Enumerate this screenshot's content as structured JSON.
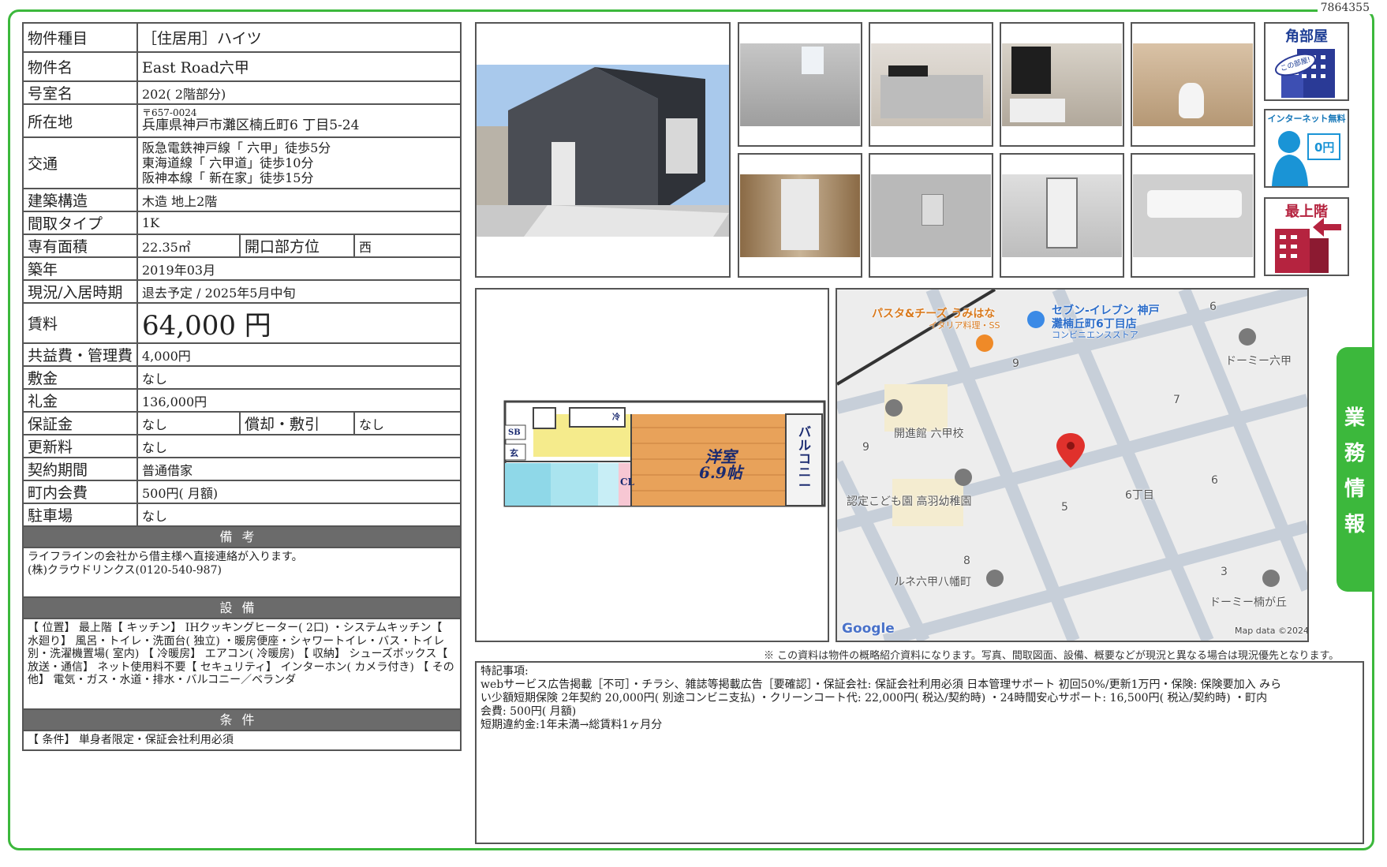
{
  "doc_id": "7864355",
  "property": {
    "type_label": "物件種目",
    "type": "［住居用］ハイツ",
    "name_label": "物件名",
    "name": "East Road六甲",
    "room_label": "号室名",
    "room": "202( 2階部分)",
    "location_label": "所在地",
    "postal": "〒657-0024",
    "address": "兵庫県神戸市灘区楠丘町6 丁目5-24",
    "traffic_label": "交通",
    "traffic": [
      "阪急電鉄神戸線「 六甲」徒歩5分",
      "東海道線「 六甲道」徒歩10分",
      "阪神本線「 新在家」徒歩15分"
    ],
    "structure_label": "建築構造",
    "structure": "木造 地上2階",
    "layout_label": "間取タイプ",
    "layout": "1K",
    "area_label": "専有面積",
    "area": "22.35㎡",
    "direction_label": "開口部方位",
    "direction": "西",
    "built_label": "築年",
    "built": "2019年03月",
    "status_label": "現況/入居時期",
    "status": "退去予定 / 2025年5月中旬",
    "rent_label": "賃料",
    "rent": "64,000 円",
    "fee_label": "共益費・管理費",
    "fee": "4,000円",
    "deposit_label": "敷金",
    "deposit": "なし",
    "key_money_label": "礼金",
    "key_money": "136,000円",
    "guarantee_label": "保証金",
    "guarantee": "なし",
    "amortization_label": "償却・敷引",
    "amortization": "なし",
    "renewal_label": "更新料",
    "renewal": "なし",
    "contract_label": "契約期間",
    "contract": "普通借家",
    "town_fee_label": "町内会費",
    "town_fee": "500円( 月額)",
    "parking_label": "駐車場",
    "parking": "なし"
  },
  "remarks_section": {
    "title": "備考",
    "lines": [
      "ライフラインの会社から借主様へ直接連絡が入ります。",
      "(株)クラウドリンクス(0120-540-987)"
    ]
  },
  "equipment_section": {
    "title": "設備",
    "text": "【 位置】 最上階【 キッチン】 IHクッキングヒーター( 2口) ・システムキッチン【 水廻り】 風呂・トイレ・洗面台( 独立) ・暖房便座・シャワートイレ・バス・トイレ別・洗濯機置場( 室内) 【 冷暖房】 エアコン( 冷暖房) 【 収納】 シューズボックス【 放送・通信】 ネット使用料不要【 セキュリティ】 インターホン( カメラ付き) 【 その他】 電気・ガス・水道・排水・バルコニー／ベランダ"
  },
  "conditions_section": {
    "title": "条件",
    "text": "【 条件】 単身者限定・保証会社利用必須"
  },
  "badges": {
    "corner": {
      "title": "角部屋",
      "sub": "この部屋!"
    },
    "internet": {
      "title": "インターネット無料",
      "sub": "0円"
    },
    "top_floor": {
      "title": "最上階"
    }
  },
  "floorplan": {
    "room": "洋室",
    "size": "6.9帖",
    "balcony": "バルコニー",
    "cl": "CL",
    "sb": "SB",
    "gen": "玄",
    "wash": "冷"
  },
  "map": {
    "labels": {
      "pasta": "パスタ&チーズ うみはな",
      "pasta_sub": "イタリア料理・SS",
      "seven": "セブン-イレブン 神戸",
      "seven2": "灘楠丘町6丁目店",
      "seven_sub": "コンビニエンスストア",
      "dormy1": "ドーミー六甲",
      "school": "開進館 六甲校",
      "kinder": "認定こども園 高羽幼稚園",
      "rune": "ルネ六甲八幡町",
      "dormy2": "ドーミー楠が丘",
      "chome": "6丁目",
      "n6a": "6",
      "n9a": "9",
      "n7": "7",
      "n9b": "9",
      "n6b": "6",
      "n5": "5",
      "n8": "8",
      "n3": "3"
    },
    "google": "Google",
    "credit": "Map data ©2024"
  },
  "disclaimer": "※ この資料は物件の概略紹介資料になります。写真、間取図面、設備、概要などが現況と異なる場合は現況優先となります。",
  "notes": {
    "lines": [
      "特記事項:",
      "webサービス広告掲載［不可］・チラシ、雑誌等掲載広告［要確認］・保証会社: 保証会社利用必須 日本管理サポート 初回50%/更新1万円・保険: 保険要加入 みら",
      "い少額短期保険 2年契約 20,000円( 別途コンビニ支払) ・クリーンコート代: 22,000円( 税込/契約時) ・24時間安心サポート: 16,500円( 税込/契約時) ・町内",
      "会費: 500円( 月額)",
      "短期違約金:1年未満→総賃料1ヶ月分"
    ]
  },
  "side_tab": [
    "業",
    "務",
    "情",
    "報"
  ]
}
